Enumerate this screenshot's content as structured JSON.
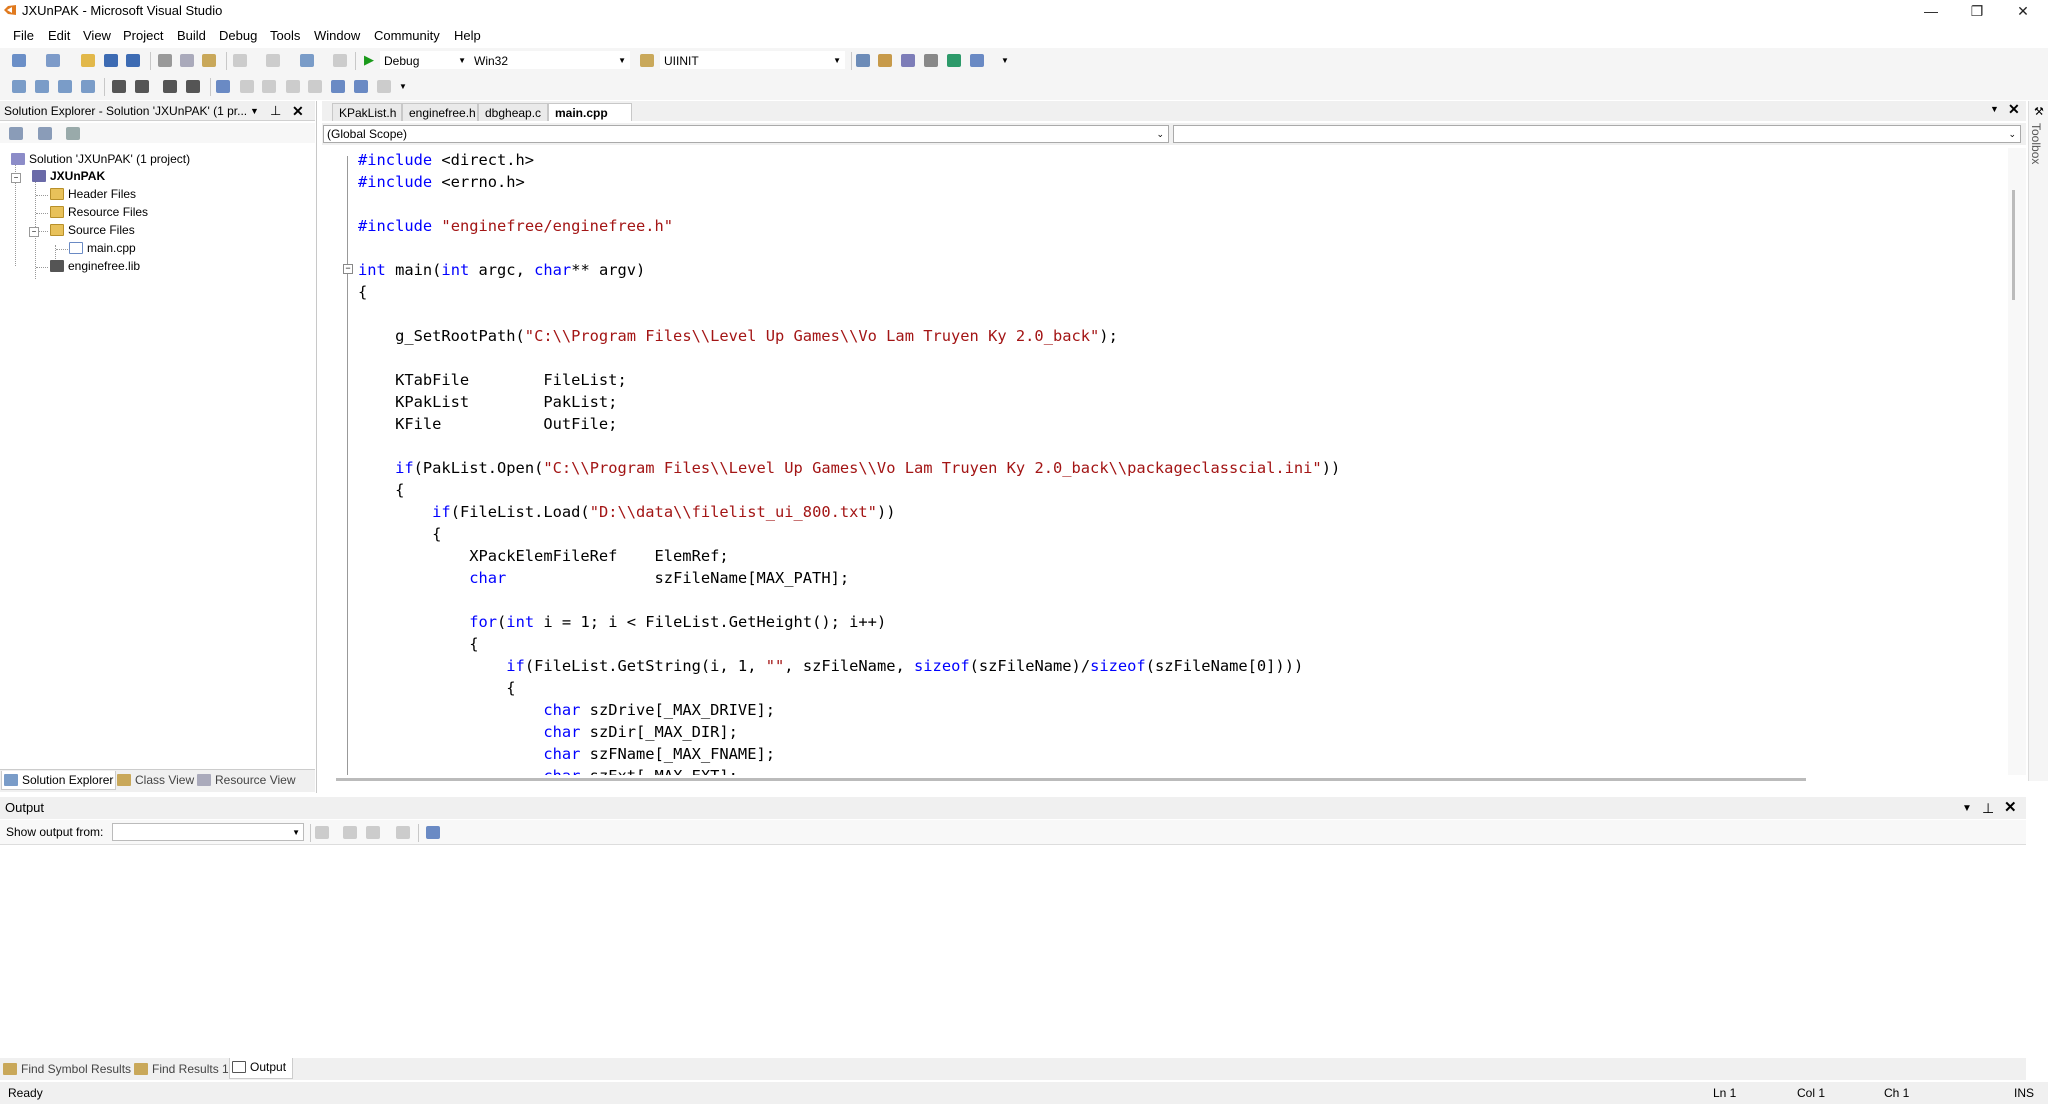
{
  "window": {
    "title": "JXUnPAK - Microsoft Visual Studio",
    "minimize": "—",
    "maximize": "❐",
    "close": "✕"
  },
  "menu": [
    "File",
    "Edit",
    "View",
    "Project",
    "Build",
    "Debug",
    "Tools",
    "Window",
    "Community",
    "Help"
  ],
  "toolbar": {
    "config": "Debug",
    "platform": "Win32",
    "find_combo": "UIINIT"
  },
  "solution_explorer": {
    "title": "Solution Explorer - Solution 'JXUnPAK' (1 pr...",
    "tree": {
      "solution": "Solution 'JXUnPAK' (1 project)",
      "project": "JXUnPAK",
      "header_files": "Header Files",
      "resource_files": "Resource Files",
      "source_files": "Source Files",
      "main_cpp": "main.cpp",
      "lib": "enginefree.lib"
    },
    "tabs": [
      "Solution Explorer",
      "Class View",
      "Resource View"
    ]
  },
  "editor": {
    "tabs": [
      "KPakList.h",
      "enginefree.h",
      "dbgheap.c",
      "main.cpp"
    ],
    "scope": "(Global Scope)",
    "member": ""
  },
  "output": {
    "title": "Output",
    "show_from_label": "Show output from:",
    "show_from_value": "",
    "tabs": [
      "Find Symbol Results",
      "Find Results 1",
      "Output"
    ]
  },
  "status": {
    "text": "Ready",
    "ln": "Ln 1",
    "col": "Col 1",
    "ch": "Ch 1",
    "mode": "INS"
  },
  "toolbox": "Toolbox",
  "colors": {
    "keyword": "#0000ff",
    "string": "#a31515",
    "panel_bg": "#f0f0f0"
  }
}
